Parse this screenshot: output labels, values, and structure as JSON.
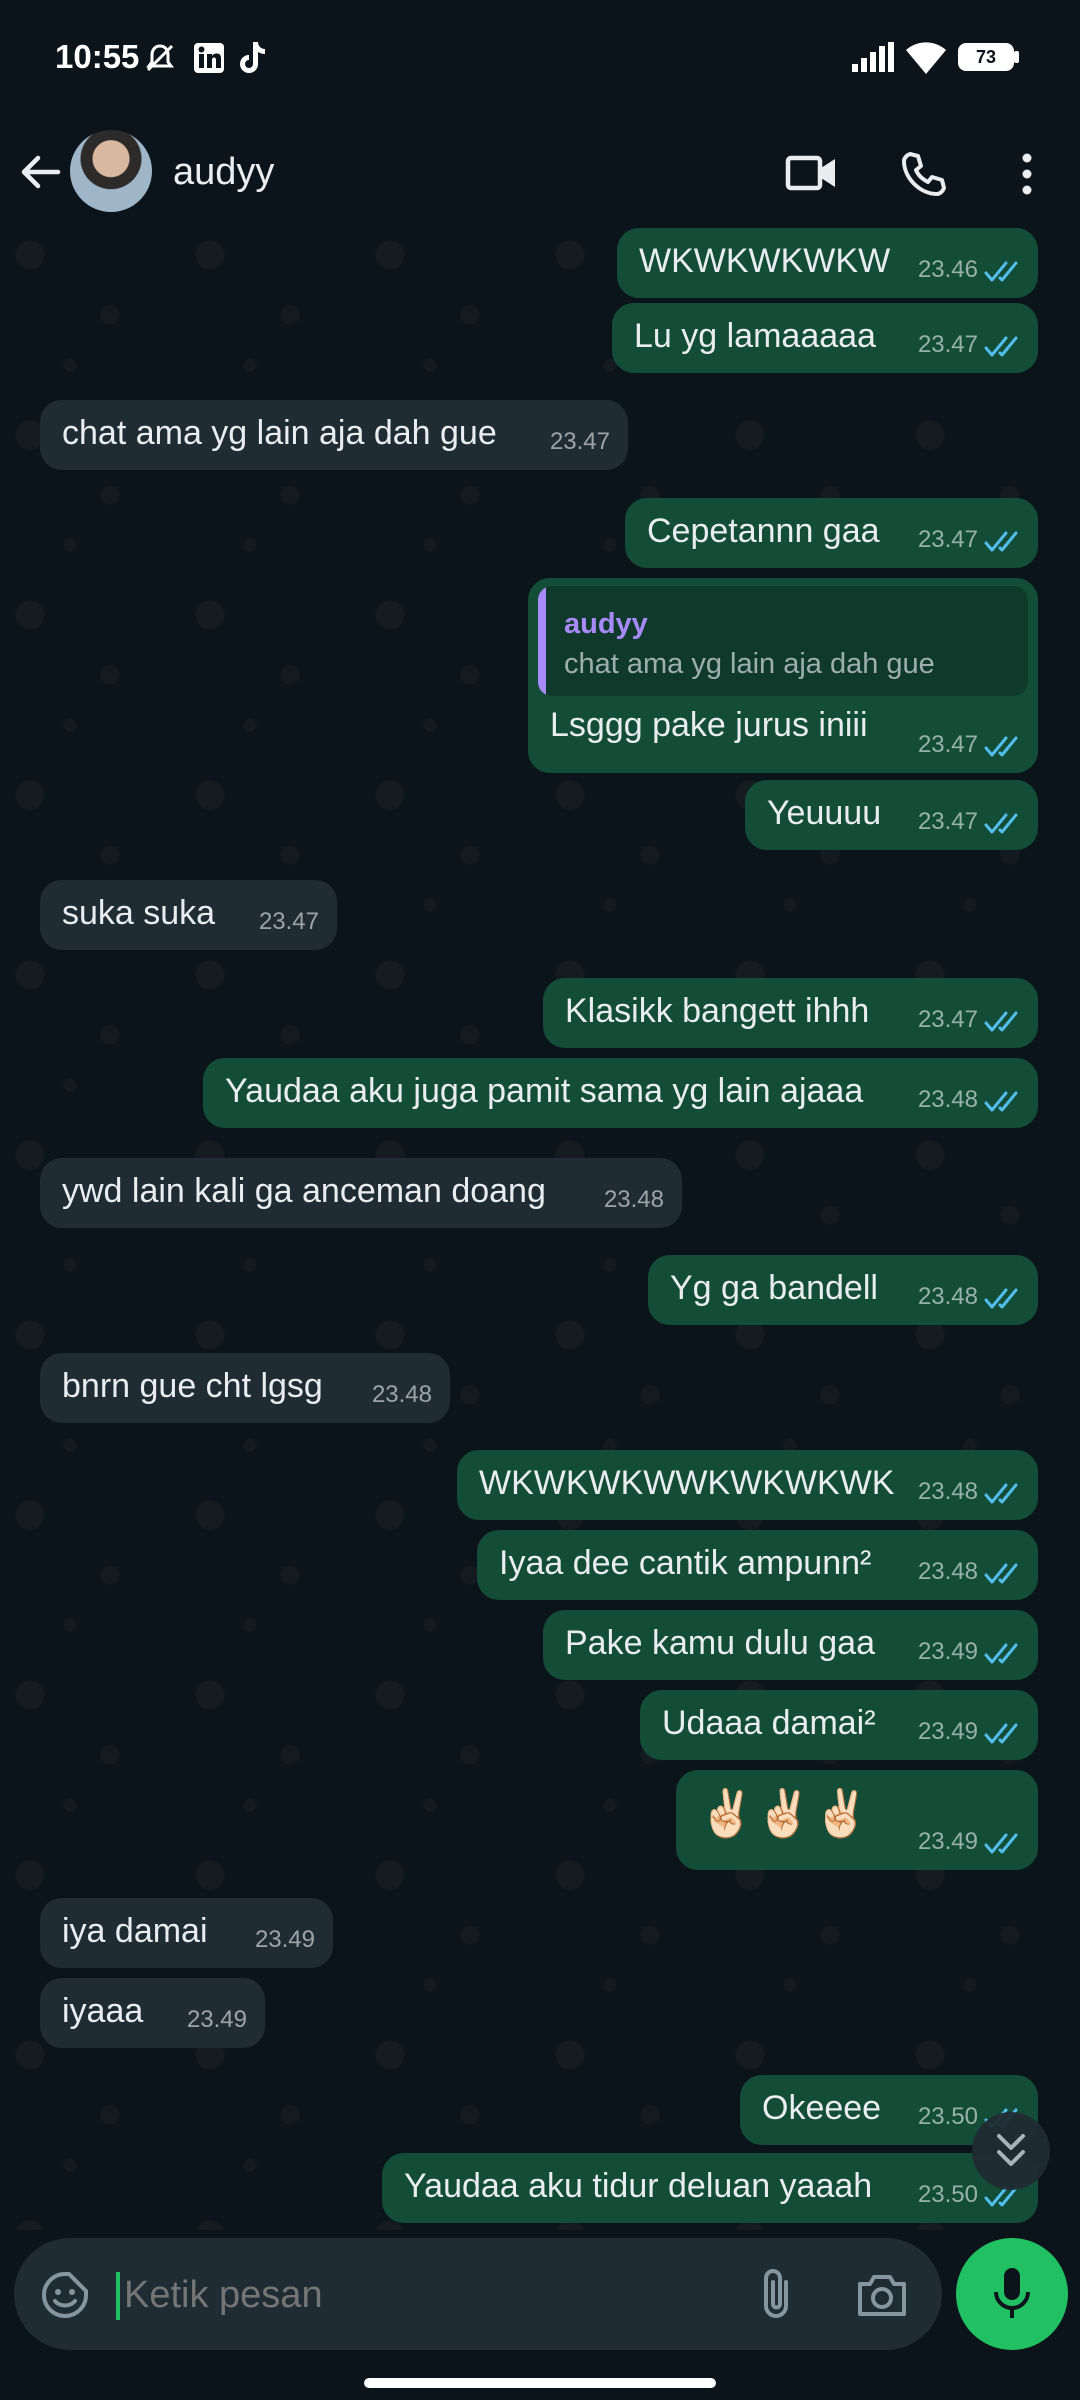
{
  "status_bar": {
    "time": "10:55",
    "battery": "73"
  },
  "header": {
    "contact_name": "audyy"
  },
  "messages": [
    {
      "id": "m1",
      "dir": "out",
      "text": "WKWKWKWKW",
      "time": "23.46"
    },
    {
      "id": "m2",
      "dir": "out",
      "text": "Lu yg lamaaaaa",
      "time": "23.47"
    },
    {
      "id": "m3",
      "dir": "in",
      "text": "chat ama yg lain aja dah gue",
      "time": "23.47"
    },
    {
      "id": "m4",
      "dir": "out",
      "text": "Cepetannn gaa",
      "time": "23.47"
    },
    {
      "id": "m5",
      "dir": "out",
      "text": "Lsggg pake jurus iniii",
      "time": "23.47",
      "quote": {
        "name": "audyy",
        "text": "chat ama yg lain aja dah gue"
      }
    },
    {
      "id": "m6",
      "dir": "out",
      "text": "Yeuuuu",
      "time": "23.47"
    },
    {
      "id": "m7",
      "dir": "in",
      "text": "suka suka",
      "time": "23.47"
    },
    {
      "id": "m8",
      "dir": "out",
      "text": "Klasikk bangett ihhh",
      "time": "23.47"
    },
    {
      "id": "m9",
      "dir": "out",
      "text": "Yaudaa aku juga pamit sama yg lain ajaaa",
      "time": "23.48"
    },
    {
      "id": "m10",
      "dir": "in",
      "text": "ywd lain kali ga anceman doang",
      "time": "23.48"
    },
    {
      "id": "m11",
      "dir": "out",
      "text": "Yg ga bandell",
      "time": "23.48"
    },
    {
      "id": "m12",
      "dir": "in",
      "text": "bnrn gue cht lgsg",
      "time": "23.48"
    },
    {
      "id": "m13",
      "dir": "out",
      "text": "WKWKWKWWKWKWKWK",
      "time": "23.48"
    },
    {
      "id": "m14",
      "dir": "out",
      "text": "Iyaa dee cantik ampunn²",
      "time": "23.48"
    },
    {
      "id": "m15",
      "dir": "out",
      "text": "Pake kamu dulu gaa",
      "time": "23.49"
    },
    {
      "id": "m16",
      "dir": "out",
      "text": "Udaaa damai²",
      "time": "23.49"
    },
    {
      "id": "m17",
      "dir": "out",
      "text": "✌🏻✌🏻✌🏻",
      "time": "23.49"
    },
    {
      "id": "m18",
      "dir": "in",
      "text": "iya damai",
      "time": "23.49"
    },
    {
      "id": "m19",
      "dir": "in",
      "text": "iyaaa",
      "time": "23.49"
    },
    {
      "id": "m20",
      "dir": "out",
      "text": "Okeeee",
      "time": "23.50"
    },
    {
      "id": "m21",
      "dir": "out",
      "text": "Yaudaa aku tidur deluan yaaah",
      "time": "23.50"
    }
  ],
  "composer": {
    "placeholder": "Ketik pesan"
  },
  "colors": {
    "background": "#0b141a",
    "outgoing_bubble": "#144d37",
    "incoming_bubble": "#202c33",
    "read_ticks": "#53bdeb",
    "accent_green": "#21c063",
    "quote_name": "#a78bfa"
  },
  "icons": {
    "back": "arrow-left-icon",
    "video": "video-camera-icon",
    "call": "phone-icon",
    "menu": "more-vertical-icon",
    "emoji": "sticker-icon",
    "attach": "paperclip-icon",
    "camera": "camera-icon",
    "mic": "microphone-icon",
    "scroll_down": "double-chevron-down-icon"
  }
}
